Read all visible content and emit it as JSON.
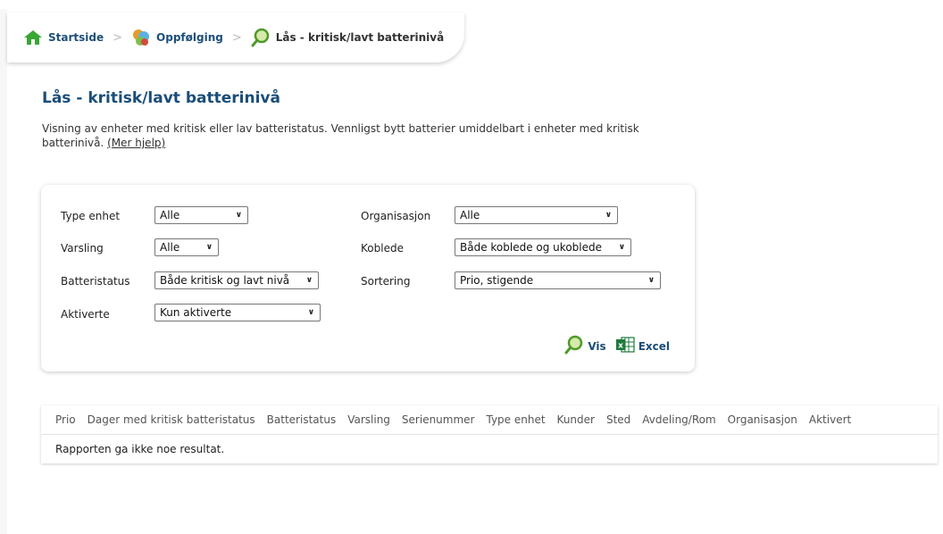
{
  "breadcrumb": {
    "home": "Startside",
    "followup": "Oppfølging",
    "current": "Lås - kritisk/lavt batterinivå"
  },
  "page": {
    "title": "Lås - kritisk/lavt batterinivå",
    "description": "Visning av enheter med kritisk eller lav batteristatus. Vennligst bytt batterier umiddelbart i enheter med kritisk batterinivå.",
    "help_link": "(Mer hjelp)"
  },
  "filters": {
    "type_enhet": {
      "label": "Type enhet",
      "value": "Alle"
    },
    "varsling": {
      "label": "Varsling",
      "value": "Alle"
    },
    "batteristatus": {
      "label": "Batteristatus",
      "value": "Både kritisk og lavt nivå"
    },
    "aktiverte": {
      "label": "Aktiverte",
      "value": "Kun aktiverte"
    },
    "organisasjon": {
      "label": "Organisasjon",
      "value": "Alle"
    },
    "koblede": {
      "label": "Koblede",
      "value": "Både koblede og ukoblede"
    },
    "sortering": {
      "label": "Sortering",
      "value": "Prio, stigende"
    }
  },
  "actions": {
    "vis": "Vis",
    "excel": "Excel"
  },
  "table": {
    "columns": [
      "Prio",
      "Dager med kritisk batteristatus",
      "Batteristatus",
      "Varsling",
      "Serienummer",
      "Type enhet",
      "Kunder",
      "Sted",
      "Avdeling/Rom",
      "Organisasjon",
      "Aktivert"
    ],
    "empty_message": "Rapporten ga ikke noe resultat."
  },
  "icons": {
    "home": "home-icon",
    "followup": "followup-icon",
    "search": "search-icon",
    "excel": "excel-icon"
  },
  "colors": {
    "title": "#1a4d78",
    "link": "#1e4f7a",
    "home_green": "#3aa635"
  }
}
